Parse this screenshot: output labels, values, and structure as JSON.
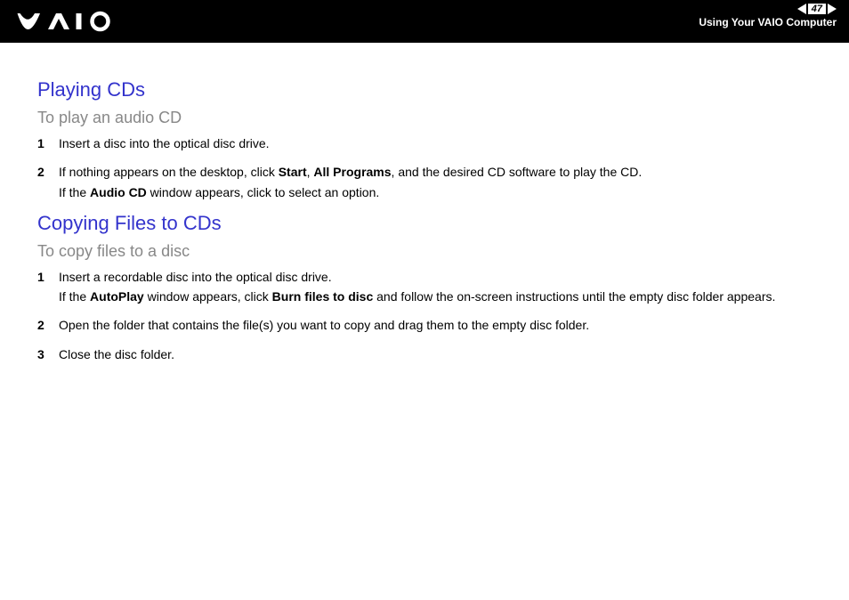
{
  "header": {
    "page_number": "47",
    "section": "Using Your VAIO Computer"
  },
  "sections": [
    {
      "heading": "Playing CDs",
      "sub": "To play an audio CD",
      "steps": [
        {
          "num": "1",
          "segments": [
            [
              "Insert a disc into the optical disc drive."
            ]
          ]
        },
        {
          "num": "2",
          "segments": [
            [
              "If nothing appears on the desktop, click ",
              "Start",
              ", ",
              "All Programs",
              ", and the desired CD software to play the CD."
            ],
            [
              "If the ",
              "Audio CD",
              " window appears, click to select an option."
            ]
          ],
          "bold_idx": [
            [
              1,
              3
            ],
            [
              1
            ]
          ]
        }
      ]
    },
    {
      "heading": "Copying Files to CDs",
      "sub": "To copy files to a disc",
      "steps": [
        {
          "num": "1",
          "segments": [
            [
              "Insert a recordable disc into the optical disc drive."
            ],
            [
              "If the ",
              "AutoPlay",
              " window appears, click ",
              "Burn files to disc",
              " and follow the on-screen instructions until the empty disc folder appears."
            ]
          ],
          "bold_idx": [
            [],
            [
              1,
              3
            ]
          ]
        },
        {
          "num": "2",
          "segments": [
            [
              "Open the folder that contains the file(s) you want to copy and drag them to the empty disc folder."
            ]
          ]
        },
        {
          "num": "3",
          "segments": [
            [
              "Close the disc folder."
            ]
          ]
        }
      ]
    }
  ]
}
